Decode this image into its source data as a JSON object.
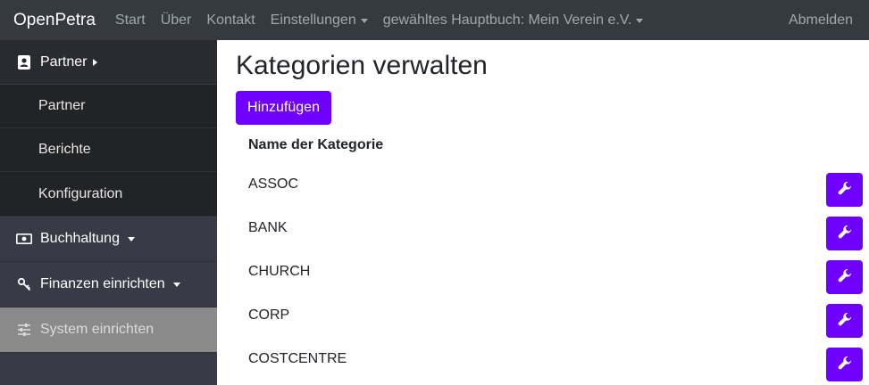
{
  "navbar": {
    "brand": "OpenPetra",
    "links": [
      "Start",
      "Über",
      "Kontakt"
    ],
    "settings": "Einstellungen",
    "ledger": "gewähltes Hauptbuch: Mein Verein e.V.",
    "logout": "Abmelden"
  },
  "sidebar": {
    "partner": {
      "label": "Partner",
      "items": [
        "Partner",
        "Berichte",
        "Konfiguration"
      ]
    },
    "accounting": "Buchhaltung",
    "finance_setup": "Finanzen einrichten",
    "system_setup": "System einrichten"
  },
  "main": {
    "title": "Kategorien verwalten",
    "add_button": "Hinzufügen",
    "column_header": "Name der Kategorie",
    "rows": [
      "ASSOC",
      "BANK",
      "CHURCH",
      "CORP",
      "COSTCENTRE"
    ]
  },
  "colors": {
    "accent": "#6f00ff",
    "navbar": "#343a40",
    "sidebar": "#383a45",
    "sidebar_submenu": "#222325",
    "sidebar_active": "#8a8a8a"
  },
  "icons": {
    "partner": "address-book-icon",
    "accounting": "money-bill-icon",
    "finance_setup": "key-icon",
    "system_setup": "sliders-icon",
    "edit": "wrench-icon"
  }
}
